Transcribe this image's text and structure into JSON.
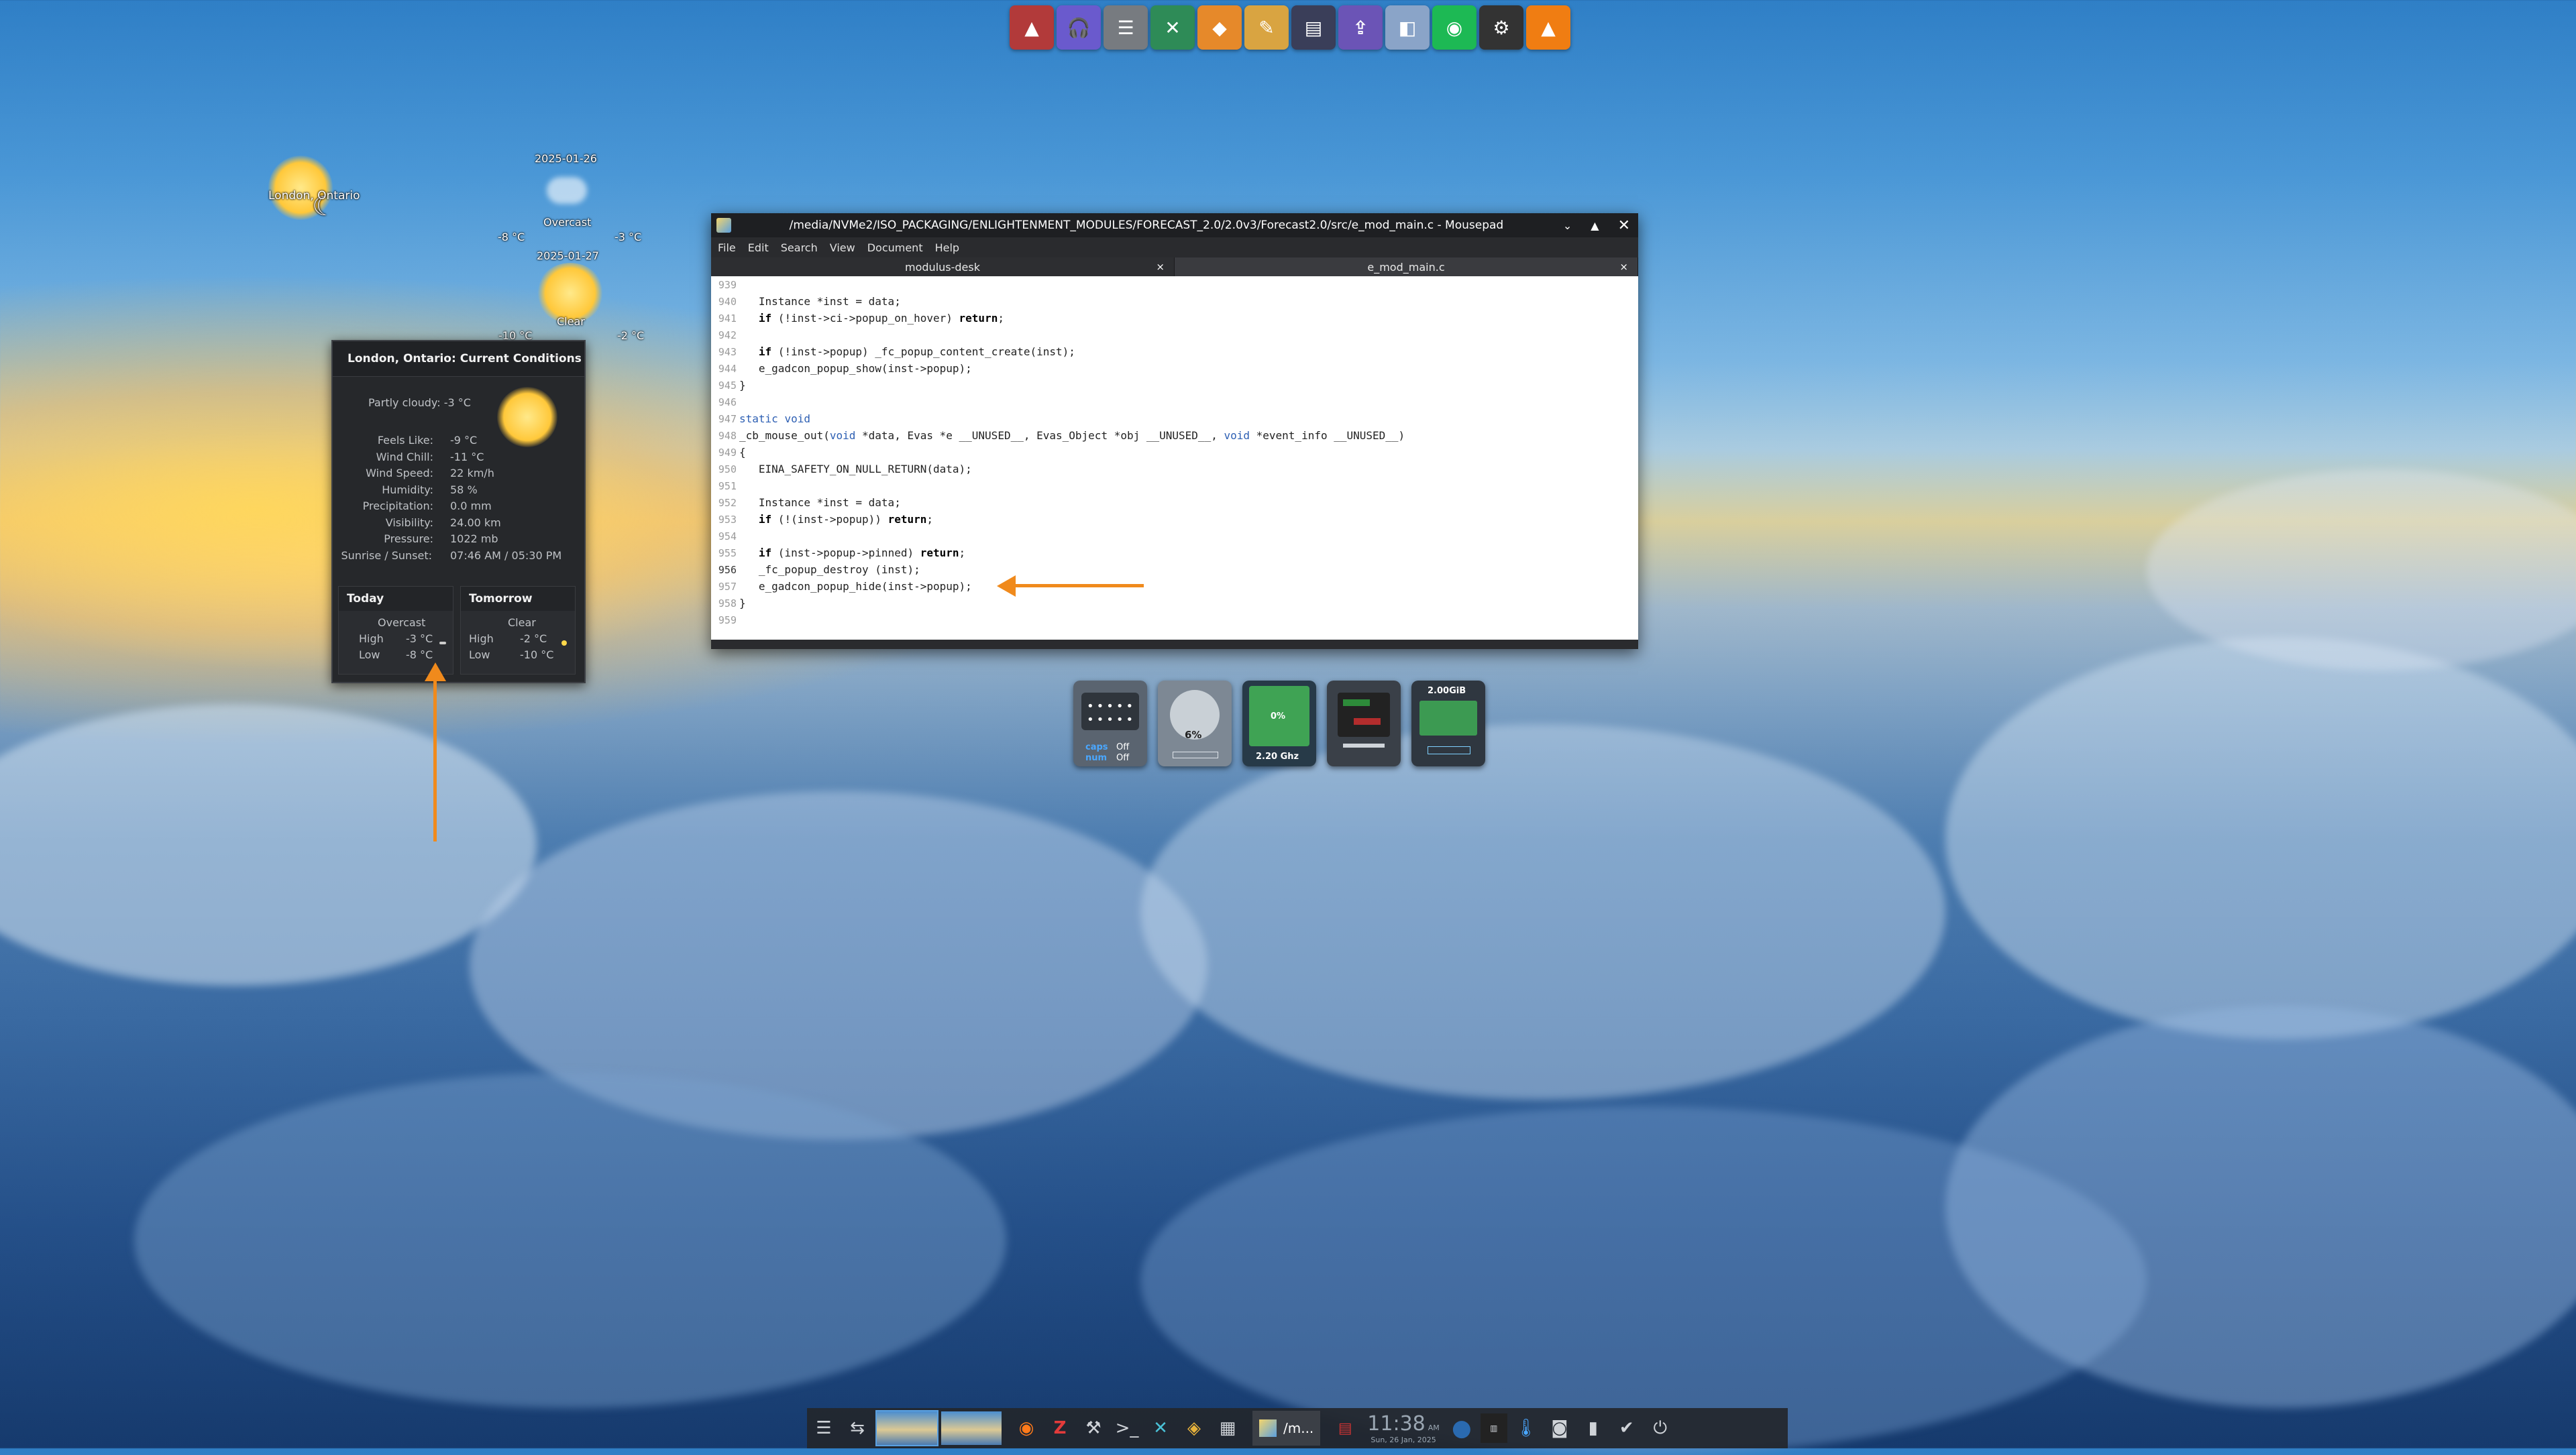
{
  "dock": {
    "items": [
      {
        "name": "app-launcher-icon",
        "color": "#b23a3a",
        "glyph": "▲"
      },
      {
        "name": "headphones-icon",
        "color": "#6a5acd",
        "glyph": "🎧"
      },
      {
        "name": "mixer-icon",
        "color": "#777b80",
        "glyph": "☰"
      },
      {
        "name": "spreadsheet-icon",
        "color": "#2e8b57",
        "glyph": "✕"
      },
      {
        "name": "vlc-like-icon",
        "color": "#e6892a",
        "glyph": "◆"
      },
      {
        "name": "tool-icon",
        "color": "#d9a441",
        "glyph": "✎"
      },
      {
        "name": "editor-icon",
        "color": "#3a3e59",
        "glyph": "▤"
      },
      {
        "name": "upload-icon",
        "color": "#6b54b6",
        "glyph": "⇪"
      },
      {
        "name": "virtualbox-icon",
        "color": "#8aa4c8",
        "glyph": "◧"
      },
      {
        "name": "spotify-icon",
        "color": "#1db954",
        "glyph": "◉"
      },
      {
        "name": "settings-icon",
        "color": "#333",
        "glyph": "⚙"
      },
      {
        "name": "vlc-icon",
        "color": "#f07d12",
        "glyph": "▲"
      }
    ]
  },
  "desktop_weather": {
    "city": "London, Ontario",
    "day1": {
      "date": "2025-01-26",
      "condition": "Overcast",
      "low": "-8 °C",
      "high": "-3 °C"
    },
    "day2": {
      "date": "2025-01-27",
      "condition": "Clear",
      "low": "-10 °C",
      "high": "-2 °C"
    }
  },
  "popup": {
    "title": "London, Ontario: Current Conditions",
    "summary": "Partly cloudy: -3 °C",
    "rows": [
      {
        "label": "Feels Like:",
        "value": "-9 °C"
      },
      {
        "label": "Wind Chill:",
        "value": "-11 °C"
      },
      {
        "label": "Wind Speed:",
        "value": "22 km/h"
      },
      {
        "label": "Humidity:",
        "value": "58 %"
      },
      {
        "label": "Precipitation:",
        "value": "0.0 mm"
      },
      {
        "label": "Visibility:",
        "value": "24.00 km"
      },
      {
        "label": "Pressure:",
        "value": "1022 mb"
      },
      {
        "label": "Sunrise / Sunset:",
        "value": "07:46 AM /    05:30 PM"
      }
    ],
    "today": {
      "head": "Today",
      "cond": "Overcast",
      "high_label": "High",
      "high": "-3 °C",
      "low_label": "Low",
      "low": "-8 °C"
    },
    "tomorrow": {
      "head": "Tomorrow",
      "cond": "Clear",
      "high_label": "High",
      "high": "-2 °C",
      "low_label": "Low",
      "low": "-10 °C"
    }
  },
  "window": {
    "title": "/media/NVMe2/ISO_PACKAGING/ENLIGHTENMENT_MODULES/FORECAST_2.0/2.0v3/Forecast2.0/src/e_mod_main.c - Mousepad",
    "menu": [
      "File",
      "Edit",
      "Search",
      "View",
      "Document",
      "Help"
    ],
    "tabs": [
      {
        "label": "modulus-desk",
        "close": "×"
      },
      {
        "label": "e_mod_main.c",
        "close": "×"
      }
    ],
    "lines": [
      {
        "n": "939",
        "t": ""
      },
      {
        "n": "940",
        "t": "   Instance *inst = data;"
      },
      {
        "n": "941",
        "t": "   if (!inst->ci->popup_on_hover) return;"
      },
      {
        "n": "942",
        "t": ""
      },
      {
        "n": "943",
        "t": "   if (!inst->popup) _fc_popup_content_create(inst);"
      },
      {
        "n": "944",
        "t": "   e_gadcon_popup_show(inst->popup);"
      },
      {
        "n": "945",
        "t": "}"
      },
      {
        "n": "946",
        "t": ""
      },
      {
        "n": "947",
        "t": "static void"
      },
      {
        "n": "948",
        "t": "_cb_mouse_out(void *data, Evas *e __UNUSED__, Evas_Object *obj __UNUSED__, void *event_info __UNUSED__)"
      },
      {
        "n": "949",
        "t": "{"
      },
      {
        "n": "950",
        "t": "   EINA_SAFETY_ON_NULL_RETURN(data);"
      },
      {
        "n": "951",
        "t": ""
      },
      {
        "n": "952",
        "t": "   Instance *inst = data;"
      },
      {
        "n": "953",
        "t": "   if (!(inst->popup)) return;"
      },
      {
        "n": "954",
        "t": ""
      },
      {
        "n": "955",
        "t": "   if (inst->popup->pinned) return;"
      },
      {
        "n": "956",
        "t": "   _fc_popup_destroy (inst);"
      },
      {
        "n": "957",
        "t": "   e_gadcon_popup_hide(inst->popup);"
      },
      {
        "n": "958",
        "t": "}"
      },
      {
        "n": "959",
        "t": ""
      }
    ]
  },
  "gadgets": {
    "keyboard": {
      "caps": "caps",
      "num": "num",
      "caps_state": "Off",
      "num_state": "Off"
    },
    "disk": {
      "value": "6%"
    },
    "cpu": {
      "value": "0%",
      "freq": "2.20 Ghz"
    },
    "memory": {
      "value": "2.00GiB"
    }
  },
  "taskbar": {
    "task_label": "/m...",
    "clock": "11:38",
    "clock_ampm": "AM",
    "date": "Sun, 26 Jan, 2025"
  }
}
